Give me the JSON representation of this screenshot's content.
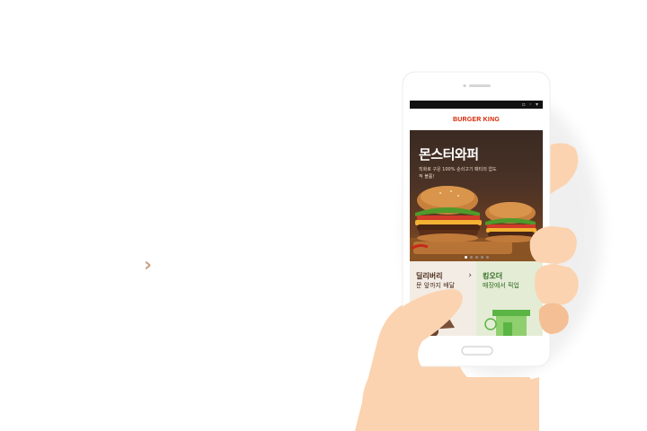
{
  "page": {
    "nav_arrow": "›"
  },
  "phone": {
    "status_icons": "▫ ◦ ▾",
    "brand": "BURGER KING",
    "hero": {
      "title": "몬스터와퍼",
      "subtitle": "직화로 구운 100% 순쇠고기 패티의 압도적 볼륨!",
      "slide_index": 1,
      "slide_count": 5
    },
    "tiles": [
      {
        "title": "딜리버리",
        "subtitle": "문 앞까지 배달",
        "arrow": "›"
      },
      {
        "title": "킹오더",
        "subtitle": "매장에서 픽업",
        "arrow": "›"
      }
    ]
  },
  "colors": {
    "brand_red": "#d62300",
    "skin": "#fbd3b0",
    "skin_shadow": "#f5bf95",
    "delivery_tile": "#f3ece5",
    "kingorder_tile": "#e4ecd5",
    "kingorder_green": "#5bb544",
    "chevron": "#c8a48a"
  }
}
